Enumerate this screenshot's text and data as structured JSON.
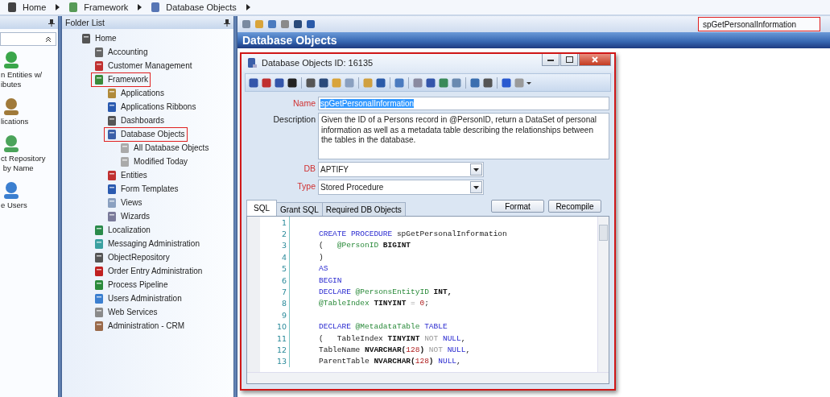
{
  "breadcrumb": [
    {
      "label": "Home"
    },
    {
      "label": "Framework"
    },
    {
      "label": "Database Objects"
    }
  ],
  "nav_pane": {
    "items": [
      {
        "label": "n Entities w/\nibutes"
      },
      {
        "label": "lications"
      },
      {
        "label": "ct Repository\n by Name"
      },
      {
        "label": "e Users"
      }
    ]
  },
  "folder_list": {
    "title": "Folder List",
    "tree": [
      {
        "label": "Home",
        "highlighted": false,
        "children": [
          {
            "label": "Accounting",
            "highlighted": false
          },
          {
            "label": "Customer Management",
            "highlighted": false
          },
          {
            "label": "Framework",
            "highlighted": true,
            "children": [
              {
                "label": "Applications",
                "highlighted": false
              },
              {
                "label": "Applications Ribbons",
                "highlighted": false
              },
              {
                "label": "Dashboards",
                "highlighted": false
              },
              {
                "label": "Database Objects",
                "highlighted": true,
                "children": [
                  {
                    "label": "All Database Objects",
                    "highlighted": false
                  },
                  {
                    "label": "Modified Today",
                    "highlighted": false
                  }
                ]
              },
              {
                "label": "Entities",
                "highlighted": false
              },
              {
                "label": "Form Templates",
                "highlighted": false
              },
              {
                "label": "Views",
                "highlighted": false
              },
              {
                "label": "Wizards",
                "highlighted": false
              }
            ]
          },
          {
            "label": "Localization",
            "highlighted": false
          },
          {
            "label": "Messaging Administration",
            "highlighted": false
          },
          {
            "label": "ObjectRepository",
            "highlighted": false
          },
          {
            "label": "Order Entry Administration",
            "highlighted": false
          },
          {
            "label": "Process Pipeline",
            "highlighted": false
          },
          {
            "label": "Users Administration",
            "highlighted": false
          },
          {
            "label": "Web Services",
            "highlighted": false
          },
          {
            "label": "Administration - CRM",
            "highlighted": false
          }
        ]
      }
    ]
  },
  "main": {
    "search": {
      "value": "spGetPersonalInformation",
      "highlighted": true
    },
    "title": "Database Objects"
  },
  "dialog": {
    "title": "Database Objects ID: 16135",
    "highlighted": true,
    "fields": [
      {
        "kind": "text",
        "label": "Name",
        "required": true,
        "value": "spGetPersonalInformation",
        "selected": true
      },
      {
        "kind": "textarea",
        "label": "Description",
        "required": false,
        "value": "Given the ID of a Persons record in @PersonID, return a DataSet of personal information as well as a metadata table describing the relationships between the tables in the database."
      },
      {
        "kind": "combo",
        "label": "DB",
        "required": true,
        "value": "APTIFY"
      },
      {
        "kind": "combo",
        "label": "Type",
        "required": true,
        "value": "Stored Procedure"
      }
    ],
    "tabs": [
      {
        "label": "SQL",
        "selected": true
      },
      {
        "label": "Grant SQL",
        "selected": false
      },
      {
        "label": "Required DB Objects",
        "selected": false
      }
    ],
    "buttons": [
      "Format",
      "Recompile"
    ],
    "code": [
      {
        "number": "1"
      },
      {
        "number": "2",
        "tokens": [
          {
            "kind": "keyword",
            "text": "CREATE PROCEDURE"
          },
          {
            "kind": "plain",
            "text": " spGetPersonalInformation"
          }
        ]
      },
      {
        "number": "3",
        "tokens": [
          {
            "kind": "plain",
            "text": "(   "
          },
          {
            "kind": "variable",
            "text": "@PersonID"
          },
          {
            "kind": "type",
            "text": " BIGINT"
          }
        ]
      },
      {
        "number": "4",
        "tokens": [
          {
            "kind": "plain",
            "text": ")"
          }
        ]
      },
      {
        "number": "5",
        "tokens": [
          {
            "kind": "keyword",
            "text": "AS"
          }
        ]
      },
      {
        "number": "6",
        "tokens": [
          {
            "kind": "keyword",
            "text": "BEGIN"
          }
        ]
      },
      {
        "number": "7",
        "tokens": [
          {
            "kind": "keyword",
            "text": "DECLARE"
          },
          {
            "kind": "variable",
            "text": " @PersonsEntityID"
          },
          {
            "kind": "type",
            "text": " INT,"
          }
        ]
      },
      {
        "number": "8",
        "tokens": [
          {
            "kind": "variable",
            "text": "@TableIndex"
          },
          {
            "kind": "type",
            "text": " TINYINT"
          },
          {
            "kind": "operator",
            "text": " = "
          },
          {
            "kind": "number",
            "text": "0"
          },
          {
            "kind": "plain",
            "text": ";"
          }
        ]
      },
      {
        "number": "9"
      },
      {
        "number": "10",
        "tokens": [
          {
            "kind": "keyword",
            "text": "DECLARE"
          },
          {
            "kind": "variable",
            "text": " @MetadataTable"
          },
          {
            "kind": "keyword",
            "text": " TABLE"
          }
        ]
      },
      {
        "number": "11",
        "tokens": [
          {
            "kind": "plain",
            "text": "(   TableIndex"
          },
          {
            "kind": "type",
            "text": " TINYINT"
          },
          {
            "kind": "operator",
            "text": " NOT"
          },
          {
            "kind": "keyword",
            "text": " NULL"
          },
          {
            "kind": "plain",
            "text": ","
          }
        ]
      },
      {
        "number": "12",
        "tokens": [
          {
            "kind": "plain",
            "text": "TableName"
          },
          {
            "kind": "type",
            "text": " NVARCHAR("
          },
          {
            "kind": "number",
            "text": "128"
          },
          {
            "kind": "type",
            "text": ")"
          },
          {
            "kind": "operator",
            "text": " NOT"
          },
          {
            "kind": "keyword",
            "text": " NULL"
          },
          {
            "kind": "plain",
            "text": ","
          }
        ]
      },
      {
        "number": "13",
        "tokens": [
          {
            "kind": "plain",
            "text": "ParentTable"
          },
          {
            "kind": "type",
            "text": " NVARCHAR("
          },
          {
            "kind": "number",
            "text": "128"
          },
          {
            "kind": "type",
            "text": ")"
          },
          {
            "kind": "keyword",
            "text": " NULL"
          },
          {
            "kind": "plain",
            "text": ","
          }
        ]
      }
    ]
  }
}
